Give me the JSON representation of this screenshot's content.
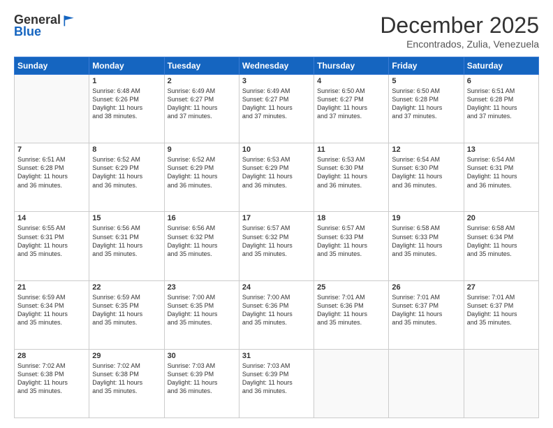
{
  "header": {
    "logo_general": "General",
    "logo_blue": "Blue",
    "month": "December 2025",
    "location": "Encontrados, Zulia, Venezuela"
  },
  "days_of_week": [
    "Sunday",
    "Monday",
    "Tuesday",
    "Wednesday",
    "Thursday",
    "Friday",
    "Saturday"
  ],
  "weeks": [
    [
      {
        "day": "",
        "info": ""
      },
      {
        "day": "1",
        "info": "Sunrise: 6:48 AM\nSunset: 6:26 PM\nDaylight: 11 hours\nand 38 minutes."
      },
      {
        "day": "2",
        "info": "Sunrise: 6:49 AM\nSunset: 6:27 PM\nDaylight: 11 hours\nand 37 minutes."
      },
      {
        "day": "3",
        "info": "Sunrise: 6:49 AM\nSunset: 6:27 PM\nDaylight: 11 hours\nand 37 minutes."
      },
      {
        "day": "4",
        "info": "Sunrise: 6:50 AM\nSunset: 6:27 PM\nDaylight: 11 hours\nand 37 minutes."
      },
      {
        "day": "5",
        "info": "Sunrise: 6:50 AM\nSunset: 6:28 PM\nDaylight: 11 hours\nand 37 minutes."
      },
      {
        "day": "6",
        "info": "Sunrise: 6:51 AM\nSunset: 6:28 PM\nDaylight: 11 hours\nand 37 minutes."
      }
    ],
    [
      {
        "day": "7",
        "info": "Sunrise: 6:51 AM\nSunset: 6:28 PM\nDaylight: 11 hours\nand 36 minutes."
      },
      {
        "day": "8",
        "info": "Sunrise: 6:52 AM\nSunset: 6:29 PM\nDaylight: 11 hours\nand 36 minutes."
      },
      {
        "day": "9",
        "info": "Sunrise: 6:52 AM\nSunset: 6:29 PM\nDaylight: 11 hours\nand 36 minutes."
      },
      {
        "day": "10",
        "info": "Sunrise: 6:53 AM\nSunset: 6:29 PM\nDaylight: 11 hours\nand 36 minutes."
      },
      {
        "day": "11",
        "info": "Sunrise: 6:53 AM\nSunset: 6:30 PM\nDaylight: 11 hours\nand 36 minutes."
      },
      {
        "day": "12",
        "info": "Sunrise: 6:54 AM\nSunset: 6:30 PM\nDaylight: 11 hours\nand 36 minutes."
      },
      {
        "day": "13",
        "info": "Sunrise: 6:54 AM\nSunset: 6:31 PM\nDaylight: 11 hours\nand 36 minutes."
      }
    ],
    [
      {
        "day": "14",
        "info": "Sunrise: 6:55 AM\nSunset: 6:31 PM\nDaylight: 11 hours\nand 35 minutes."
      },
      {
        "day": "15",
        "info": "Sunrise: 6:56 AM\nSunset: 6:31 PM\nDaylight: 11 hours\nand 35 minutes."
      },
      {
        "day": "16",
        "info": "Sunrise: 6:56 AM\nSunset: 6:32 PM\nDaylight: 11 hours\nand 35 minutes."
      },
      {
        "day": "17",
        "info": "Sunrise: 6:57 AM\nSunset: 6:32 PM\nDaylight: 11 hours\nand 35 minutes."
      },
      {
        "day": "18",
        "info": "Sunrise: 6:57 AM\nSunset: 6:33 PM\nDaylight: 11 hours\nand 35 minutes."
      },
      {
        "day": "19",
        "info": "Sunrise: 6:58 AM\nSunset: 6:33 PM\nDaylight: 11 hours\nand 35 minutes."
      },
      {
        "day": "20",
        "info": "Sunrise: 6:58 AM\nSunset: 6:34 PM\nDaylight: 11 hours\nand 35 minutes."
      }
    ],
    [
      {
        "day": "21",
        "info": "Sunrise: 6:59 AM\nSunset: 6:34 PM\nDaylight: 11 hours\nand 35 minutes."
      },
      {
        "day": "22",
        "info": "Sunrise: 6:59 AM\nSunset: 6:35 PM\nDaylight: 11 hours\nand 35 minutes."
      },
      {
        "day": "23",
        "info": "Sunrise: 7:00 AM\nSunset: 6:35 PM\nDaylight: 11 hours\nand 35 minutes."
      },
      {
        "day": "24",
        "info": "Sunrise: 7:00 AM\nSunset: 6:36 PM\nDaylight: 11 hours\nand 35 minutes."
      },
      {
        "day": "25",
        "info": "Sunrise: 7:01 AM\nSunset: 6:36 PM\nDaylight: 11 hours\nand 35 minutes."
      },
      {
        "day": "26",
        "info": "Sunrise: 7:01 AM\nSunset: 6:37 PM\nDaylight: 11 hours\nand 35 minutes."
      },
      {
        "day": "27",
        "info": "Sunrise: 7:01 AM\nSunset: 6:37 PM\nDaylight: 11 hours\nand 35 minutes."
      }
    ],
    [
      {
        "day": "28",
        "info": "Sunrise: 7:02 AM\nSunset: 6:38 PM\nDaylight: 11 hours\nand 35 minutes."
      },
      {
        "day": "29",
        "info": "Sunrise: 7:02 AM\nSunset: 6:38 PM\nDaylight: 11 hours\nand 35 minutes."
      },
      {
        "day": "30",
        "info": "Sunrise: 7:03 AM\nSunset: 6:39 PM\nDaylight: 11 hours\nand 36 minutes."
      },
      {
        "day": "31",
        "info": "Sunrise: 7:03 AM\nSunset: 6:39 PM\nDaylight: 11 hours\nand 36 minutes."
      },
      {
        "day": "",
        "info": ""
      },
      {
        "day": "",
        "info": ""
      },
      {
        "day": "",
        "info": ""
      }
    ]
  ]
}
